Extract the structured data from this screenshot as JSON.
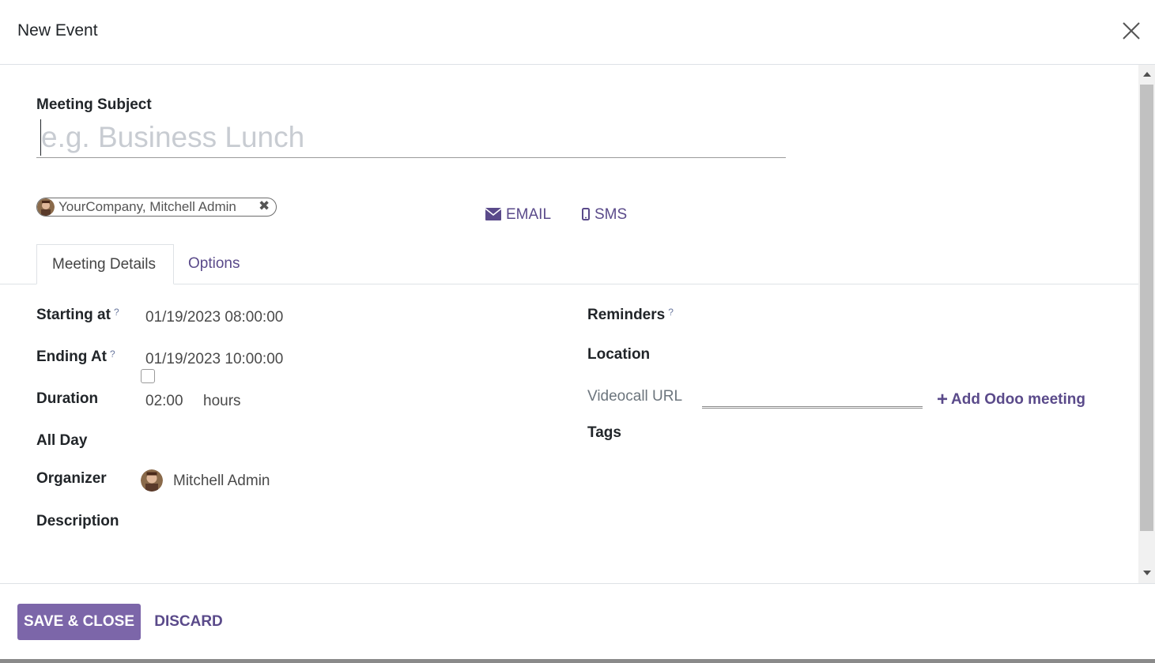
{
  "dialog": {
    "title": "New Event",
    "close_icon": "close-icon"
  },
  "form": {
    "subject_label": "Meeting Subject",
    "subject_placeholder": "e.g. Business Lunch",
    "subject_value": "",
    "attendee_tag": "YourCompany, Mitchell Admin",
    "email_label": "EMAIL",
    "sms_label": "SMS"
  },
  "tabs": [
    {
      "label": "Meeting Details",
      "active": true
    },
    {
      "label": "Options",
      "active": false
    }
  ],
  "details": {
    "starting_label": "Starting at",
    "starting_value": "01/19/2023 08:00:00",
    "ending_label": "Ending At",
    "ending_value": "01/19/2023 10:00:00",
    "duration_label": "Duration",
    "duration_value": "02:00",
    "duration_unit": "hours",
    "allday_label": "All Day",
    "allday_checked": false,
    "organizer_label": "Organizer",
    "organizer_value": "Mitchell Admin",
    "description_label": "Description",
    "help_mark": "?",
    "reminders_label": "Reminders",
    "location_label": "Location",
    "videocall_label": "Videocall URL",
    "add_meeting_label": "Add Odoo meeting",
    "tags_label": "Tags"
  },
  "footer": {
    "save_label": "SAVE & CLOSE",
    "discard_label": "DISCARD"
  },
  "colors": {
    "primary": "#7c66a9",
    "link": "#5a4a8a"
  }
}
